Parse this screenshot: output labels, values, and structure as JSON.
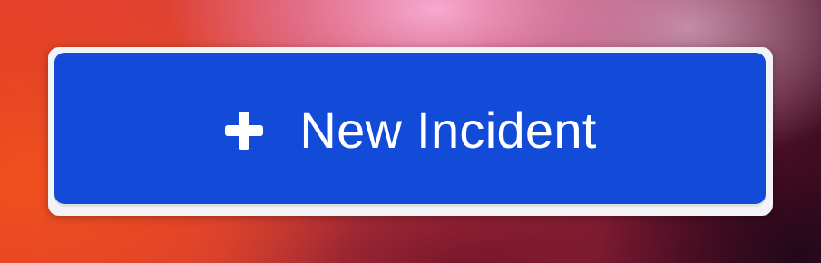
{
  "new_incident_button": {
    "label": "New Incident",
    "icon": "plus-icon"
  },
  "colors": {
    "button_bg": "#124bd8",
    "button_text": "#ffffff",
    "frame_bg": "#f3f3f5"
  }
}
